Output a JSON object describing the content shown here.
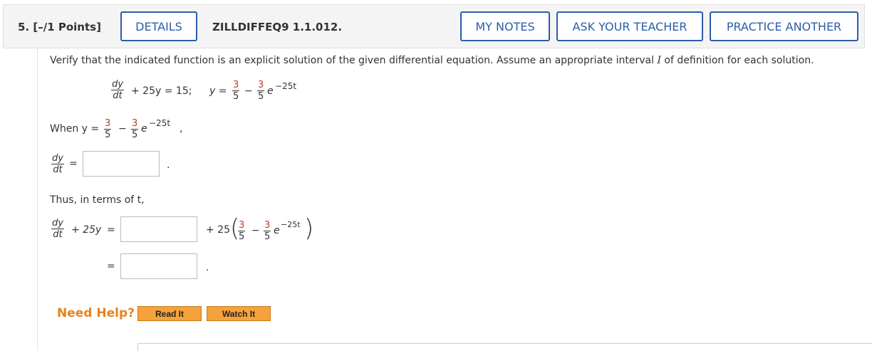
{
  "header": {
    "question_number": "5. [–/1 Points]",
    "details_label": "DETAILS",
    "question_id": "ZILLDIFFEQ9 1.1.012.",
    "my_notes_label": "MY NOTES",
    "ask_teacher_label": "ASK YOUR TEACHER",
    "practice_another_label": "PRACTICE ANOTHER"
  },
  "problem": {
    "instruction_part1": "Verify that the indicated function is an explicit solution of the given differential equation. Assume an appropriate interval ",
    "instruction_I": "I",
    "instruction_part2": " of definition for each solution.",
    "eq_dy": "dy",
    "eq_dt": "dt",
    "eq_rest": "+ 25y = 15;",
    "y_eq": "y =",
    "frac_num": "3",
    "frac_den": "5",
    "minus": "−",
    "e": "e",
    "exp": "−25t",
    "when_label": "When y =",
    "comma": ",",
    "equals": "=",
    "period": ".",
    "thus_label": "Thus, in terms of t,",
    "plus_25y": "+ 25y",
    "plus_25": "+ 25",
    "answer1": "",
    "answer2": "",
    "answer3": ""
  },
  "help": {
    "need_help": "Need Help?",
    "read_it": "Read It",
    "watch_it": "Watch It"
  }
}
